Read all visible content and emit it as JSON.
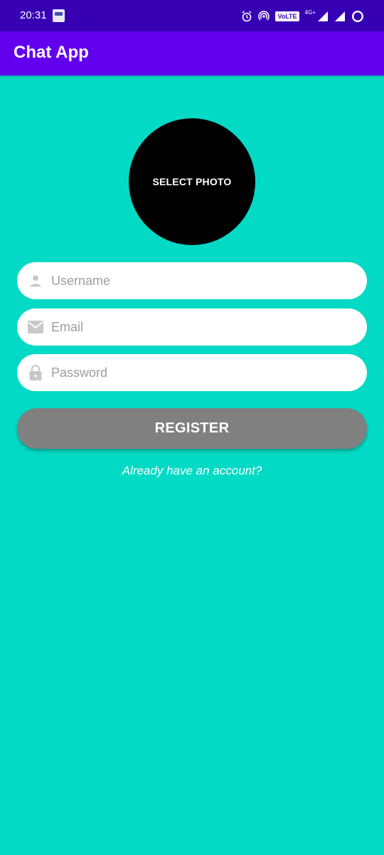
{
  "status_bar": {
    "time": "20:31",
    "volte": "VoLTE",
    "network": "4G+"
  },
  "app_bar": {
    "title": "Chat App"
  },
  "photo": {
    "label": "SELECT PHOTO"
  },
  "form": {
    "username": {
      "placeholder": "Username",
      "value": "",
      "icon": "person-icon"
    },
    "email": {
      "placeholder": "Email",
      "value": "",
      "icon": "mail-icon"
    },
    "password": {
      "placeholder": "Password",
      "value": "",
      "icon": "lock-icon"
    }
  },
  "register_button": {
    "label": "REGISTER"
  },
  "login_link": {
    "label": "Already have an account?"
  },
  "colors": {
    "status_bar": "#3700B3",
    "app_bar": "#6200EE",
    "background": "#03DAC5",
    "button": "#808080",
    "photo_circle": "#000000"
  }
}
